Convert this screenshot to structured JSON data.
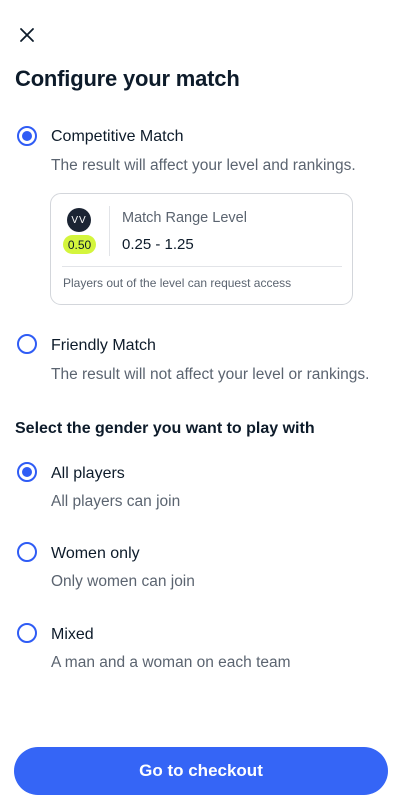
{
  "header": {
    "close_icon": "close-icon",
    "title": "Configure your match"
  },
  "match_type": {
    "options": [
      {
        "label": "Competitive Match",
        "description": "The result will affect your level and rankings.",
        "selected": true
      },
      {
        "label": "Friendly Match",
        "description": "The result will not affect your level or rankings.",
        "selected": false
      }
    ],
    "level_card": {
      "avatar_initials": "VV",
      "player_level": "0.50",
      "range_title": "Match Range Level",
      "range_value": "0.25 - 1.25",
      "note": "Players out of the level can request access"
    }
  },
  "gender": {
    "title": "Select the gender you want to play with",
    "options": [
      {
        "label": "All players",
        "description": "All players can join",
        "selected": true
      },
      {
        "label": "Women only",
        "description": "Only women can join",
        "selected": false
      },
      {
        "label": "Mixed",
        "description": "A man and a woman on each team",
        "selected": false
      }
    ]
  },
  "footer": {
    "checkout_label": "Go to checkout"
  },
  "colors": {
    "accent": "#3565f6",
    "level_badge": "#d4f53c",
    "title_text": "#0d1b2a",
    "muted_text": "#5b6470"
  }
}
